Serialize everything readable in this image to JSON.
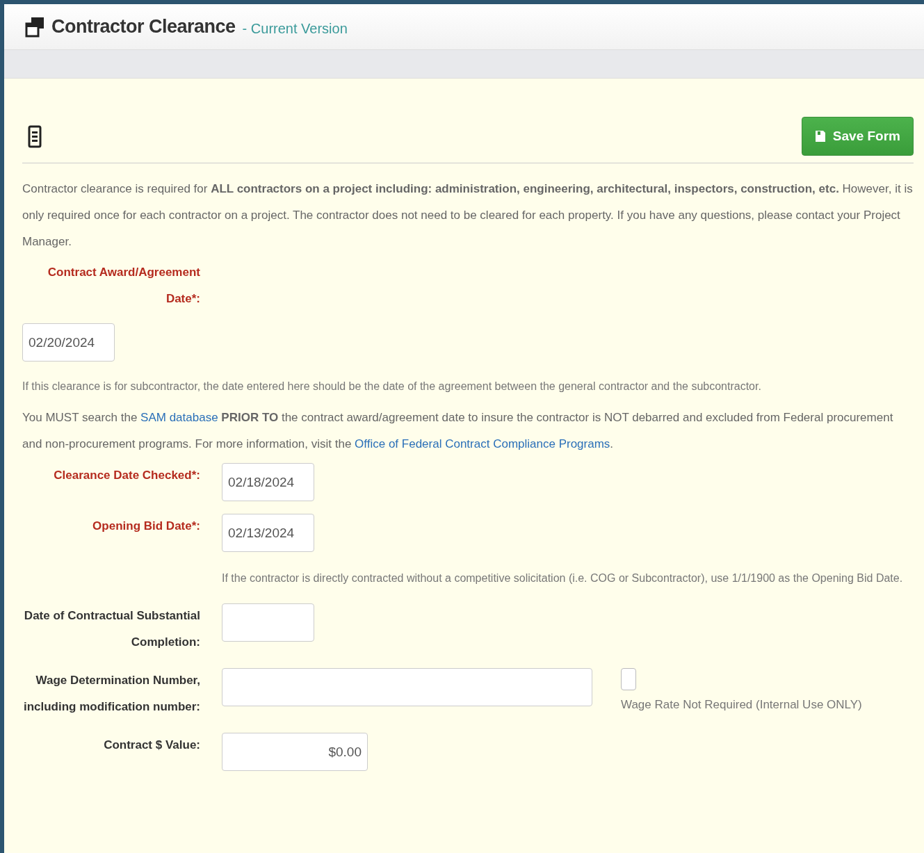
{
  "header": {
    "title": "Contractor Clearance",
    "subtitle": "- Current Version"
  },
  "save_button": "Save Form",
  "intro": "Contractor clearance is required for **ALL contractors on a project including: administration, engineering, architectural, inspectors, construction, etc.** However, it is only required once for each contractor on a project. The contractor does not need to be cleared for each property. If you have any questions, please contact your Project Manager.",
  "award_field": {
    "label": "Contract Award/Agreement Date*:",
    "required": true,
    "value": "02/20/2024"
  },
  "award_note": "If this clearance is for subcontractor, the date entered here should be the date of the agreement between the general contractor and the subcontractor.",
  "sam_notice": [
    {
      "kind": "text",
      "text": "You MUST search the "
    },
    {
      "kind": "link",
      "text": "SAM database"
    },
    {
      "kind": "text",
      "text": " **PRIOR TO** the contract award/agreement date to insure the contractor is NOT debarred and excluded from Federal procurement and non-procurement programs. For more information, visit the "
    },
    {
      "kind": "link",
      "text": "Office of Federal Contract Compliance Programs"
    },
    {
      "kind": "text",
      "text": "."
    }
  ],
  "fields": [
    {
      "kind": "date",
      "label": "Clearance Date Checked*:",
      "required": true,
      "value": "02/18/2024"
    },
    {
      "kind": "date",
      "label": "Opening Bid Date*:",
      "required": true,
      "value": "02/13/2024",
      "note": "If the contractor is directly contracted without a competitive solicitation (i.e. COG or Subcontractor), use 1/1/1900 as the Opening Bid Date."
    },
    {
      "kind": "date",
      "label": "Date of Contractual Substantial Completion:",
      "required": false
    },
    {
      "kind": "wide",
      "label": "Wage Determination Number, including modification number:",
      "required": false,
      "checkbox": {
        "label": "Wage Rate Not Required (Internal Use ONLY)",
        "checked": false
      }
    },
    {
      "kind": "currency",
      "label": "Contract $ Value:",
      "required": false,
      "value": "$0.00"
    }
  ]
}
